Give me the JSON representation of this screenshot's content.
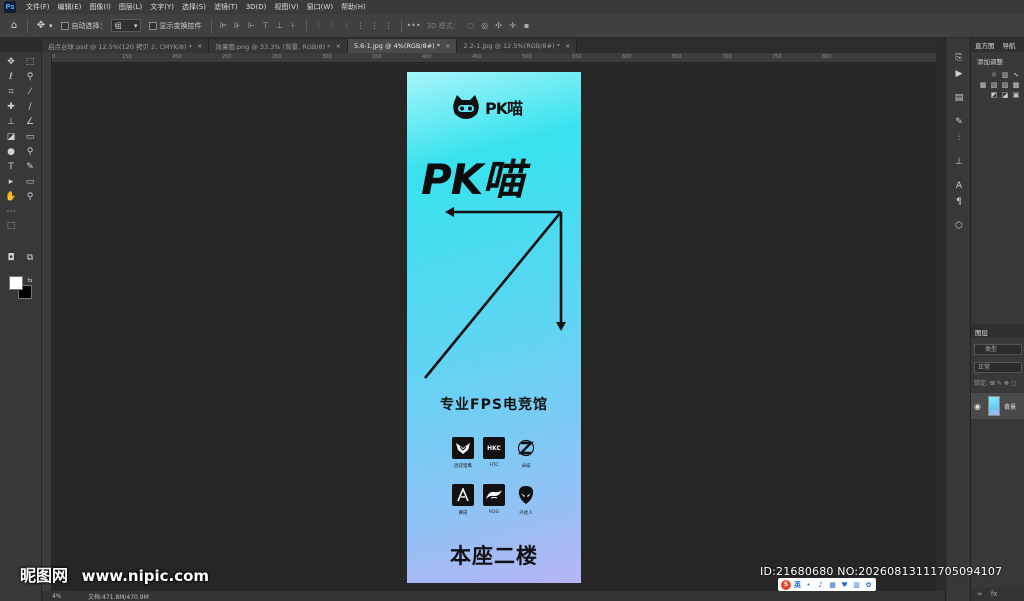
{
  "app": {
    "logo": "Ps",
    "menu": [
      "文件(F)",
      "编辑(E)",
      "图像(I)",
      "图层(L)",
      "文字(Y)",
      "选择(S)",
      "滤镜(T)",
      "3D(D)",
      "视图(V)",
      "窗口(W)",
      "帮助(H)"
    ]
  },
  "options": {
    "auto_select_label": "自动选择：",
    "auto_select_value": "组",
    "show_transform_label": "显示变换控件",
    "mode_3d_label": "3D 模式："
  },
  "tabs": [
    {
      "label": "启点台球.psd @ 12.5%(120 拷贝 2, CMYK/8) *"
    },
    {
      "label": "效果图.png @ 33.3% (背景, RGB/8) *"
    },
    {
      "label": "5.6-1.jpg @ 4%(RGB/8#) *"
    },
    {
      "label": "2.2-1.jpg @ 12.5%(RGB/8#) *"
    }
  ],
  "ruler_ticks": [
    "0",
    "150",
    "450",
    "200",
    "250",
    "300",
    "350",
    "400",
    "450",
    "500",
    "550",
    "600",
    "650",
    "700",
    "750",
    "800"
  ],
  "document": {
    "logo_text": "PK喵",
    "title": "PK喵",
    "subtitle": "专业FPS电竞馆",
    "brands": [
      {
        "name": "因叔猎鹰",
        "mark": "falcon-icon"
      },
      {
        "name": "HTC",
        "mark": "HKC"
      },
      {
        "name": "卓威",
        "mark": "zowie-icon"
      },
      {
        "name": "赛皮",
        "mark": "alienware-a-icon"
      },
      {
        "name": "ROG",
        "mark": "rog-icon"
      },
      {
        "name": "外星人",
        "mark": "alien-icon"
      }
    ],
    "floor": "本座二楼",
    "colors": {
      "gradient_top": "#a6f6fa",
      "gradient_mid": "#5fd5f3",
      "gradient_bottom": "#b8b4f6"
    }
  },
  "right_panel": {
    "tab_histogram": "直方图",
    "tab_navigator": "导航",
    "add_adjustment": "添加调整",
    "layers_title": "图层",
    "kind_filter": "类型",
    "blend_mode": "正常",
    "lock_label": "锁定:",
    "layer_name": "背景"
  },
  "status": {
    "zoom": "4%",
    "doc_size": "文档:471.8M/470.9M"
  },
  "watermark": {
    "site_cn": "昵图网",
    "site_url": "www.nipic.com",
    "id_text": "ID:21680680 NO:20260813111705094107"
  },
  "ime": {
    "lang": "英"
  }
}
